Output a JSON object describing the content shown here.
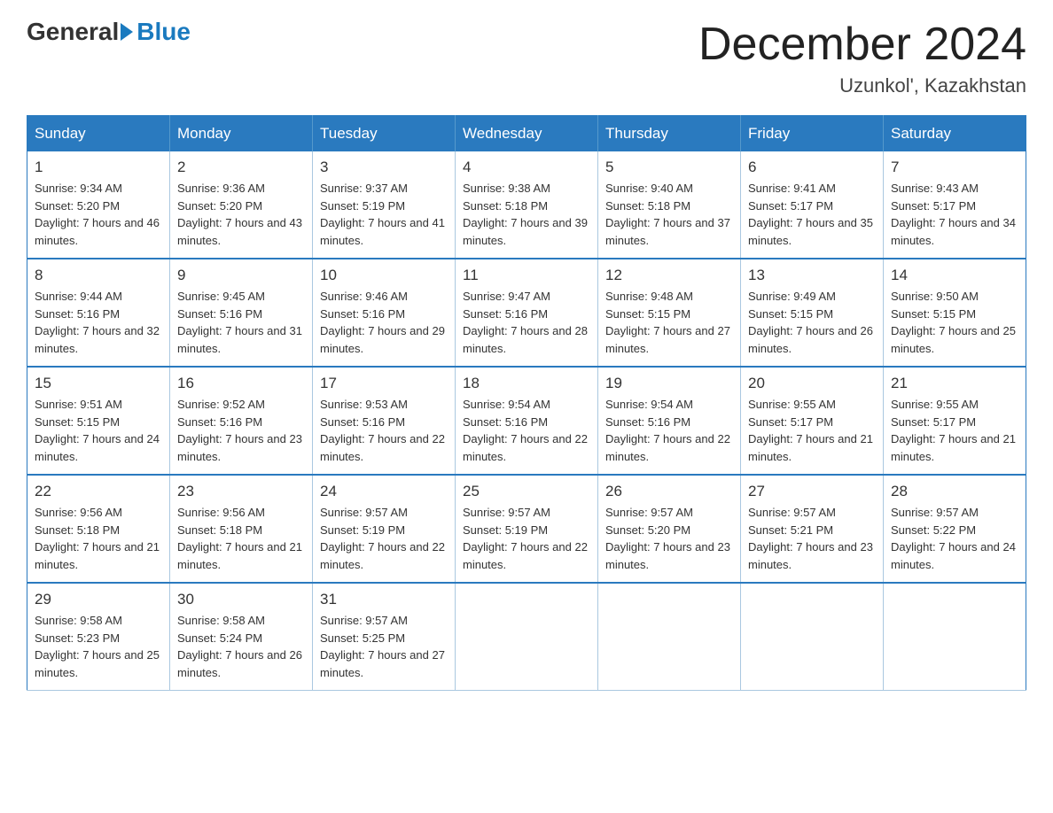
{
  "logo": {
    "general": "General",
    "blue": "Blue"
  },
  "title": {
    "month": "December 2024",
    "location": "Uzunkol', Kazakhstan"
  },
  "days_of_week": [
    "Sunday",
    "Monday",
    "Tuesday",
    "Wednesday",
    "Thursday",
    "Friday",
    "Saturday"
  ],
  "weeks": [
    [
      {
        "day": "1",
        "sunrise": "9:34 AM",
        "sunset": "5:20 PM",
        "daylight": "7 hours and 46 minutes."
      },
      {
        "day": "2",
        "sunrise": "9:36 AM",
        "sunset": "5:20 PM",
        "daylight": "7 hours and 43 minutes."
      },
      {
        "day": "3",
        "sunrise": "9:37 AM",
        "sunset": "5:19 PM",
        "daylight": "7 hours and 41 minutes."
      },
      {
        "day": "4",
        "sunrise": "9:38 AM",
        "sunset": "5:18 PM",
        "daylight": "7 hours and 39 minutes."
      },
      {
        "day": "5",
        "sunrise": "9:40 AM",
        "sunset": "5:18 PM",
        "daylight": "7 hours and 37 minutes."
      },
      {
        "day": "6",
        "sunrise": "9:41 AM",
        "sunset": "5:17 PM",
        "daylight": "7 hours and 35 minutes."
      },
      {
        "day": "7",
        "sunrise": "9:43 AM",
        "sunset": "5:17 PM",
        "daylight": "7 hours and 34 minutes."
      }
    ],
    [
      {
        "day": "8",
        "sunrise": "9:44 AM",
        "sunset": "5:16 PM",
        "daylight": "7 hours and 32 minutes."
      },
      {
        "day": "9",
        "sunrise": "9:45 AM",
        "sunset": "5:16 PM",
        "daylight": "7 hours and 31 minutes."
      },
      {
        "day": "10",
        "sunrise": "9:46 AM",
        "sunset": "5:16 PM",
        "daylight": "7 hours and 29 minutes."
      },
      {
        "day": "11",
        "sunrise": "9:47 AM",
        "sunset": "5:16 PM",
        "daylight": "7 hours and 28 minutes."
      },
      {
        "day": "12",
        "sunrise": "9:48 AM",
        "sunset": "5:15 PM",
        "daylight": "7 hours and 27 minutes."
      },
      {
        "day": "13",
        "sunrise": "9:49 AM",
        "sunset": "5:15 PM",
        "daylight": "7 hours and 26 minutes."
      },
      {
        "day": "14",
        "sunrise": "9:50 AM",
        "sunset": "5:15 PM",
        "daylight": "7 hours and 25 minutes."
      }
    ],
    [
      {
        "day": "15",
        "sunrise": "9:51 AM",
        "sunset": "5:15 PM",
        "daylight": "7 hours and 24 minutes."
      },
      {
        "day": "16",
        "sunrise": "9:52 AM",
        "sunset": "5:16 PM",
        "daylight": "7 hours and 23 minutes."
      },
      {
        "day": "17",
        "sunrise": "9:53 AM",
        "sunset": "5:16 PM",
        "daylight": "7 hours and 22 minutes."
      },
      {
        "day": "18",
        "sunrise": "9:54 AM",
        "sunset": "5:16 PM",
        "daylight": "7 hours and 22 minutes."
      },
      {
        "day": "19",
        "sunrise": "9:54 AM",
        "sunset": "5:16 PM",
        "daylight": "7 hours and 22 minutes."
      },
      {
        "day": "20",
        "sunrise": "9:55 AM",
        "sunset": "5:17 PM",
        "daylight": "7 hours and 21 minutes."
      },
      {
        "day": "21",
        "sunrise": "9:55 AM",
        "sunset": "5:17 PM",
        "daylight": "7 hours and 21 minutes."
      }
    ],
    [
      {
        "day": "22",
        "sunrise": "9:56 AM",
        "sunset": "5:18 PM",
        "daylight": "7 hours and 21 minutes."
      },
      {
        "day": "23",
        "sunrise": "9:56 AM",
        "sunset": "5:18 PM",
        "daylight": "7 hours and 21 minutes."
      },
      {
        "day": "24",
        "sunrise": "9:57 AM",
        "sunset": "5:19 PM",
        "daylight": "7 hours and 22 minutes."
      },
      {
        "day": "25",
        "sunrise": "9:57 AM",
        "sunset": "5:19 PM",
        "daylight": "7 hours and 22 minutes."
      },
      {
        "day": "26",
        "sunrise": "9:57 AM",
        "sunset": "5:20 PM",
        "daylight": "7 hours and 23 minutes."
      },
      {
        "day": "27",
        "sunrise": "9:57 AM",
        "sunset": "5:21 PM",
        "daylight": "7 hours and 23 minutes."
      },
      {
        "day": "28",
        "sunrise": "9:57 AM",
        "sunset": "5:22 PM",
        "daylight": "7 hours and 24 minutes."
      }
    ],
    [
      {
        "day": "29",
        "sunrise": "9:58 AM",
        "sunset": "5:23 PM",
        "daylight": "7 hours and 25 minutes."
      },
      {
        "day": "30",
        "sunrise": "9:58 AM",
        "sunset": "5:24 PM",
        "daylight": "7 hours and 26 minutes."
      },
      {
        "day": "31",
        "sunrise": "9:57 AM",
        "sunset": "5:25 PM",
        "daylight": "7 hours and 27 minutes."
      },
      null,
      null,
      null,
      null
    ]
  ]
}
